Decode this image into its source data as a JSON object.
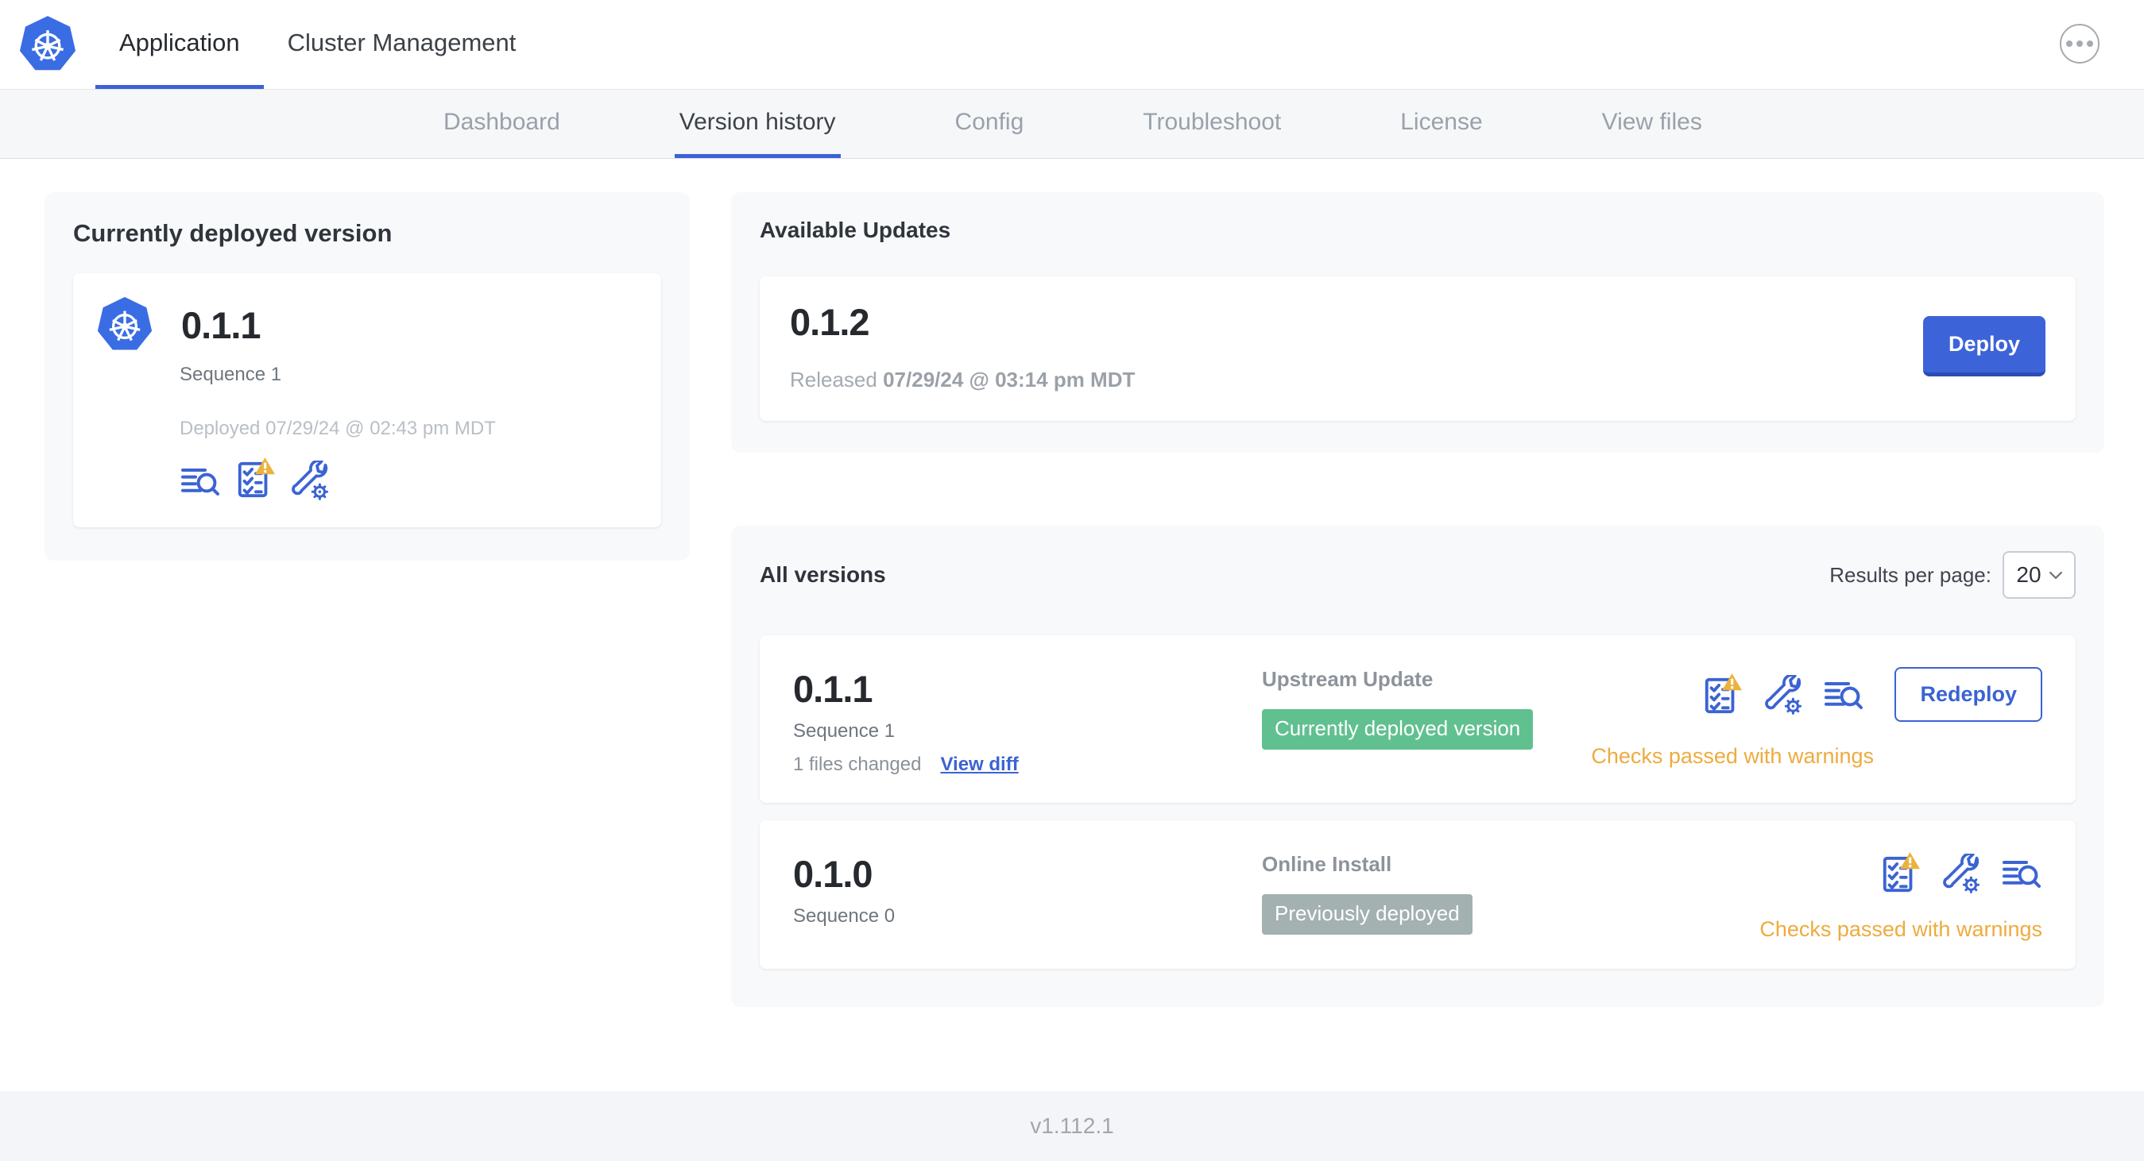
{
  "header": {
    "tabs": [
      {
        "label": "Application",
        "active": true
      },
      {
        "label": "Cluster Management",
        "active": false
      }
    ]
  },
  "nav": {
    "tabs": [
      {
        "label": "Dashboard",
        "active": false
      },
      {
        "label": "Version history",
        "active": true
      },
      {
        "label": "Config",
        "active": false
      },
      {
        "label": "Troubleshoot",
        "active": false
      },
      {
        "label": "License",
        "active": false
      },
      {
        "label": "View files",
        "active": false
      }
    ]
  },
  "current_version": {
    "title": "Currently deployed version",
    "version": "0.1.1",
    "sequence": "Sequence 1",
    "deployed": "Deployed 07/29/24 @ 02:43 pm MDT",
    "icons": [
      "logs-icon",
      "preflight-checks-warning-icon",
      "config-wrench-icon"
    ]
  },
  "available_updates": {
    "title": "Available Updates",
    "version": "0.1.2",
    "released_prefix": "Released",
    "released_date": "07/29/24 @ 03:14 pm MDT",
    "deploy_label": "Deploy"
  },
  "all_versions": {
    "title": "All versions",
    "results_per_page_label": "Results per page:",
    "results_per_page_value": "20",
    "rows": [
      {
        "version": "0.1.1",
        "sequence": "Sequence 1",
        "files_changed": "1 files changed",
        "view_diff_label": "View diff",
        "source": "Upstream Update",
        "badge": "Currently deployed version",
        "badge_color": "#61c08f",
        "action_label": "Redeploy",
        "checks": "Checks passed with warnings"
      },
      {
        "version": "0.1.0",
        "sequence": "Sequence 0",
        "source": "Online Install",
        "badge": "Previously deployed",
        "badge_color": "#a3b1b0",
        "checks": "Checks passed with warnings"
      }
    ]
  },
  "footer": {
    "app_version": "v1.112.1"
  },
  "colors": {
    "brand_blue": "#3b63d8",
    "button_blue": "#3d63d8",
    "badge_green": "#61c08f",
    "badge_gray": "#a3b1b0",
    "warning_amber": "#eeab3f",
    "nav_bg": "#f6f7f9",
    "panel_bg": "#f8f9fb"
  }
}
